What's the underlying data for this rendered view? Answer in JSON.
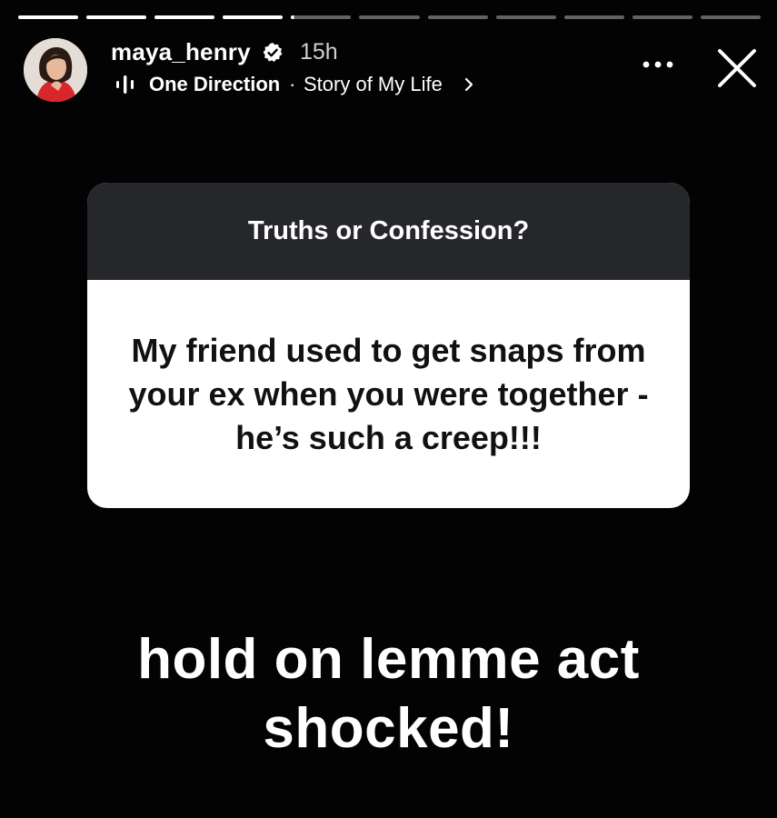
{
  "progress": {
    "segments_total": 11,
    "segments_completed": 4,
    "current_segment_fraction": 0.05
  },
  "header": {
    "username": "maya_henry",
    "verified": true,
    "time_ago": "15h",
    "music": {
      "artist": "One Direction",
      "separator": "·",
      "song": "Story of My Life"
    },
    "icons": [
      "avatar",
      "verified-badge-icon",
      "music-bars-icon",
      "chevron-right-icon",
      "more-options-icon",
      "close-icon"
    ]
  },
  "question_card": {
    "title": "Truths or Confession?",
    "question": "My friend used to get snaps from your ex when you were together - he’s such a creep!!!"
  },
  "caption": "hold on lemme act shocked!",
  "colors": {
    "background": "#030303",
    "card_header": "#26272b",
    "card_body": "#ffffff",
    "text_light": "#ffffff"
  }
}
